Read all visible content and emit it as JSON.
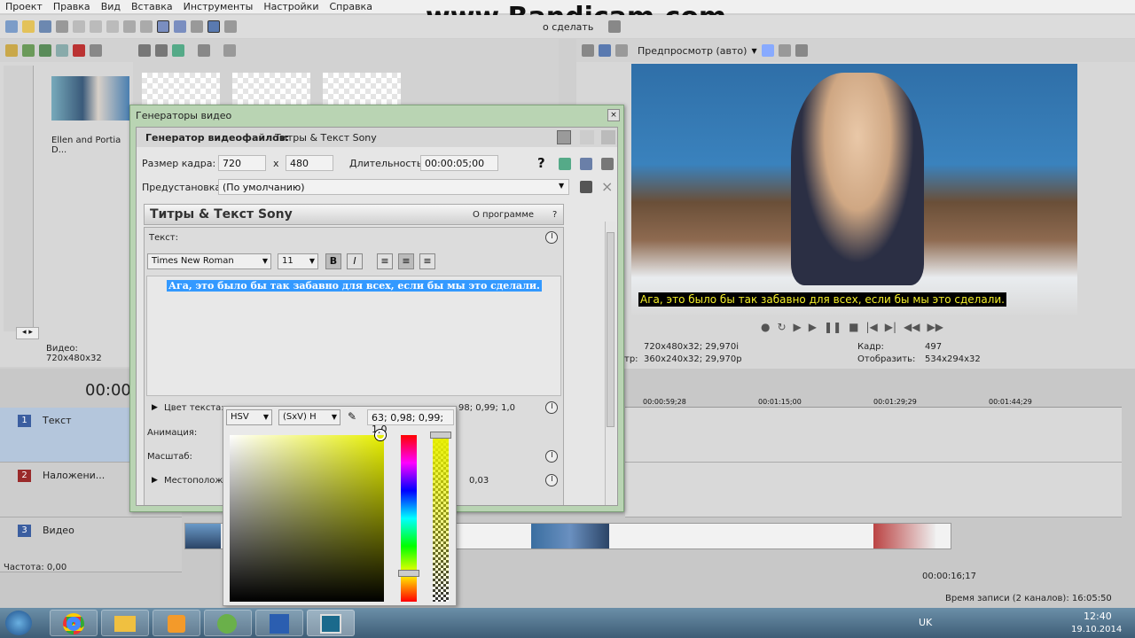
{
  "menu": [
    "Проект",
    "Правка",
    "Вид",
    "Вставка",
    "Инструменты",
    "Настройки",
    "Справка"
  ],
  "watermark": "www.Bandicam.com",
  "toolbar_undo": "о сделать",
  "preview_mode": "Предпросмотр (авто)",
  "media": {
    "clip_name": "Ellen and Portia D...",
    "video_info": "Видео: 720x480x32"
  },
  "dialog": {
    "title": "Генераторы видео",
    "generator_label": "Генератор видеофайлов:",
    "generator_value": "Титры & Текст Sony",
    "frame_size_label": "Размер кадра:",
    "width": "720",
    "x": "x",
    "height": "480",
    "duration_label": "Длительность:",
    "duration": "00:00:05;00",
    "help": "?",
    "preset_label": "Предустановка:",
    "preset_value": "(По умолчанию)",
    "plugin_title": "Титры & Текст Sony",
    "about": "О программе",
    "about_q": "?",
    "text_label": "Текст:",
    "font": "Times New Roman",
    "size": "11",
    "bold": "B",
    "italic": "I",
    "content": "Ага, это было бы так забавно для всех, если бы мы это сделали.",
    "text_color_label": "Цвет текста:",
    "text_color_value": "98; 0,99; 1,0",
    "animation_label": "Анимация:",
    "scale_label": "Масштаб:",
    "position_label": "Местополож",
    "position_value": "0,03"
  },
  "picker": {
    "mode": "HSV",
    "channel": "(SxV) H",
    "value": "63; 0,98; 0,99; 1,0"
  },
  "preview": {
    "subtitle": "Ага, это было бы так забавно для всех, если бы мы это сделали.",
    "project_label": "720x480x32; 29,970i",
    "preview_label": "тр:",
    "preview_res": "360x240x32; 29,970p",
    "frame_label": "Кадр:",
    "frame": "497",
    "display_label": "Отобразить:",
    "display": "534x294x32"
  },
  "timeline": {
    "time": "00:00",
    "marks": [
      "00:00:59;28",
      "00:01:15;00",
      "00:01:29;29",
      "00:01:44;29"
    ],
    "tracks": [
      {
        "num": "1",
        "name": "Текст",
        "color": "#3b5ea0"
      },
      {
        "num": "2",
        "name": "Наложени...",
        "color": "#9a2a2a"
      },
      {
        "num": "3",
        "name": "Видео",
        "color": "#3b5ea0"
      }
    ],
    "rate_label": "Частота: 0,00",
    "cursor_time": "00:00:16;17",
    "record_label": "Время записи (2 каналов): 16:05:50"
  },
  "taskbar": {
    "lang": "UK",
    "time": "12:40",
    "date": "19.10.2014"
  }
}
